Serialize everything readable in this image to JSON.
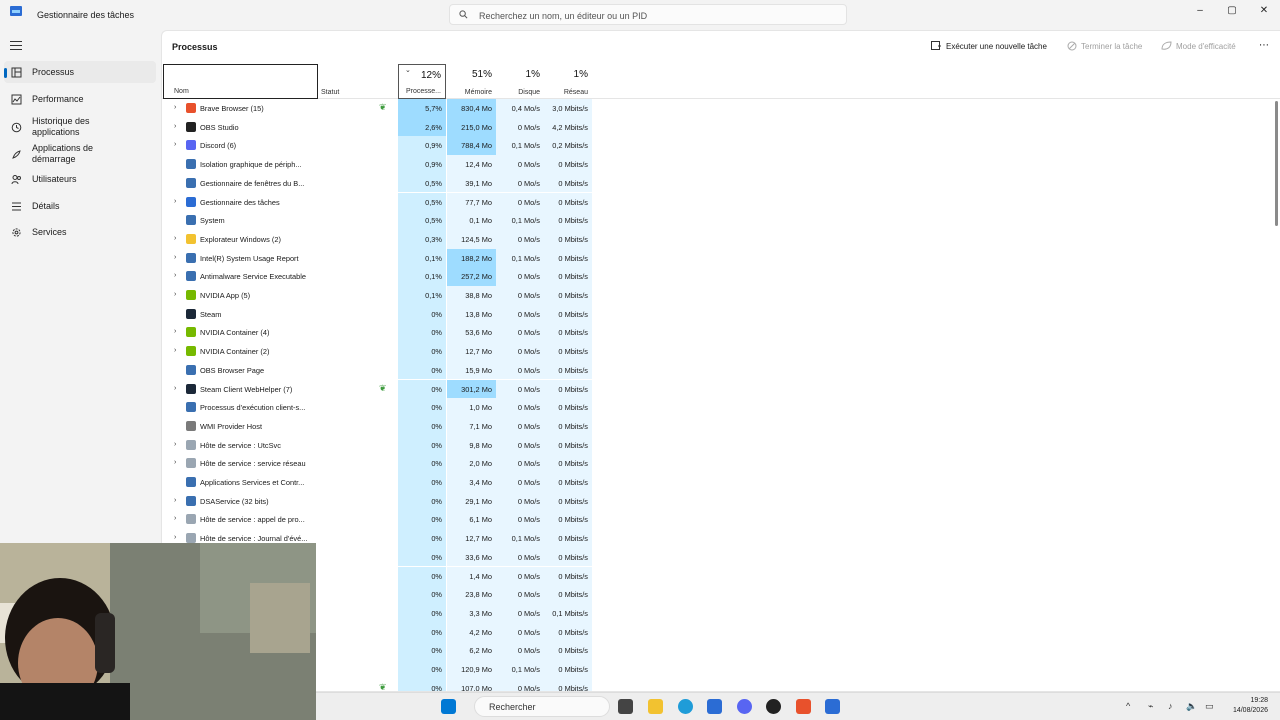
{
  "app": {
    "title": "Gestionnaire des tâches"
  },
  "search": {
    "placeholder": "Recherchez un nom, un éditeur ou un PID"
  },
  "window_controls": {
    "minimize": "–",
    "maximize": "▢",
    "close": "✕"
  },
  "sidebar": {
    "items": [
      {
        "label": "Processus",
        "icon": "processes-icon",
        "active": true
      },
      {
        "label": "Performance",
        "icon": "performance-icon"
      },
      {
        "label": "Historique des applications",
        "icon": "history-icon"
      },
      {
        "label": "Applications de démarrage",
        "icon": "startup-icon"
      },
      {
        "label": "Utilisateurs",
        "icon": "users-icon"
      },
      {
        "label": "Détails",
        "icon": "details-icon"
      },
      {
        "label": "Services",
        "icon": "services-icon"
      }
    ]
  },
  "main": {
    "title": "Processus",
    "toolbar": {
      "run_task": "Exécuter une nouvelle tâche",
      "end_task": "Terminer la tâche",
      "efficiency": "Mode d'efficacité",
      "more": "⋯"
    },
    "columns": {
      "name": "Nom",
      "status": "Statut",
      "cpu": {
        "pct": "12%",
        "label": "Processe..."
      },
      "memory": {
        "pct": "51%",
        "label": "Mémoire"
      },
      "disk": {
        "pct": "1%",
        "label": "Disque"
      },
      "network": {
        "pct": "1%",
        "label": "Réseau"
      }
    },
    "rows": [
      {
        "name": "Brave Browser (15)",
        "expand": true,
        "icon_color": "#e8512c",
        "leaf": true,
        "cpu": "5,7%",
        "mem": "830,4 Mo",
        "disk": "0,4 Mo/s",
        "net": "3,0 Mbits/s"
      },
      {
        "name": "OBS Studio",
        "expand": true,
        "icon_color": "#222222",
        "leaf": false,
        "cpu": "2,6%",
        "mem": "215,0 Mo",
        "disk": "0 Mo/s",
        "net": "4,2 Mbits/s"
      },
      {
        "name": "Discord (6)",
        "expand": true,
        "icon_color": "#5865f2",
        "leaf": false,
        "cpu": "0,9%",
        "mem": "788,4 Mo",
        "disk": "0,1 Mo/s",
        "net": "0,2 Mbits/s"
      },
      {
        "name": "Isolation graphique de périph...",
        "expand": false,
        "icon_color": "#3a6fb0",
        "leaf": false,
        "cpu": "0,9%",
        "mem": "12,4 Mo",
        "disk": "0 Mo/s",
        "net": "0 Mbits/s"
      },
      {
        "name": "Gestionnaire de fenêtres du B...",
        "expand": false,
        "icon_color": "#3a6fb0",
        "leaf": false,
        "cpu": "0,5%",
        "mem": "39,1 Mo",
        "disk": "0 Mo/s",
        "net": "0 Mbits/s"
      },
      {
        "name": "Gestionnaire des tâches",
        "expand": true,
        "icon_color": "#2b6cd4",
        "leaf": false,
        "cpu": "0,5%",
        "mem": "77,7 Mo",
        "disk": "0 Mo/s",
        "net": "0 Mbits/s"
      },
      {
        "name": "System",
        "expand": false,
        "icon_color": "#3a6fb0",
        "leaf": false,
        "cpu": "0,5%",
        "mem": "0,1 Mo",
        "disk": "0,1 Mo/s",
        "net": "0 Mbits/s"
      },
      {
        "name": "Explorateur Windows (2)",
        "expand": true,
        "icon_color": "#f2c230",
        "leaf": false,
        "cpu": "0,3%",
        "mem": "124,5 Mo",
        "disk": "0 Mo/s",
        "net": "0 Mbits/s"
      },
      {
        "name": "Intel(R) System Usage Report",
        "expand": true,
        "icon_color": "#3a6fb0",
        "leaf": false,
        "cpu": "0,1%",
        "mem": "188,2 Mo",
        "disk": "0,1 Mo/s",
        "net": "0 Mbits/s"
      },
      {
        "name": "Antimalware Service Executable",
        "expand": true,
        "icon_color": "#3a6fb0",
        "leaf": false,
        "cpu": "0,1%",
        "mem": "257,2 Mo",
        "disk": "0 Mo/s",
        "net": "0 Mbits/s"
      },
      {
        "name": "NVIDIA App (5)",
        "expand": true,
        "icon_color": "#76b900",
        "leaf": false,
        "cpu": "0,1%",
        "mem": "38,8 Mo",
        "disk": "0 Mo/s",
        "net": "0 Mbits/s"
      },
      {
        "name": "Steam",
        "expand": false,
        "icon_color": "#1b2838",
        "leaf": false,
        "cpu": "0%",
        "mem": "13,8 Mo",
        "disk": "0 Mo/s",
        "net": "0 Mbits/s"
      },
      {
        "name": "NVIDIA Container (4)",
        "expand": true,
        "icon_color": "#76b900",
        "leaf": false,
        "cpu": "0%",
        "mem": "53,6 Mo",
        "disk": "0 Mo/s",
        "net": "0 Mbits/s"
      },
      {
        "name": "NVIDIA Container (2)",
        "expand": true,
        "icon_color": "#76b900",
        "leaf": false,
        "cpu": "0%",
        "mem": "12,7 Mo",
        "disk": "0 Mo/s",
        "net": "0 Mbits/s"
      },
      {
        "name": "OBS Browser Page",
        "expand": false,
        "icon_color": "#3a6fb0",
        "leaf": false,
        "cpu": "0%",
        "mem": "15,9 Mo",
        "disk": "0 Mo/s",
        "net": "0 Mbits/s"
      },
      {
        "name": "Steam Client WebHelper (7)",
        "expand": true,
        "icon_color": "#1b2838",
        "leaf": true,
        "cpu": "0%",
        "mem": "301,2 Mo",
        "disk": "0 Mo/s",
        "net": "0 Mbits/s"
      },
      {
        "name": "Processus d'exécution client-s...",
        "expand": false,
        "icon_color": "#3a6fb0",
        "leaf": false,
        "cpu": "0%",
        "mem": "1,0 Mo",
        "disk": "0 Mo/s",
        "net": "0 Mbits/s"
      },
      {
        "name": "WMI Provider Host",
        "expand": false,
        "icon_color": "#7a7a7a",
        "leaf": false,
        "cpu": "0%",
        "mem": "7,1 Mo",
        "disk": "0 Mo/s",
        "net": "0 Mbits/s"
      },
      {
        "name": "Hôte de service : UtcSvc",
        "expand": true,
        "icon_color": "#9aa6b2",
        "leaf": false,
        "cpu": "0%",
        "mem": "9,8 Mo",
        "disk": "0 Mo/s",
        "net": "0 Mbits/s"
      },
      {
        "name": "Hôte de service : service réseau",
        "expand": true,
        "icon_color": "#9aa6b2",
        "leaf": false,
        "cpu": "0%",
        "mem": "2,0 Mo",
        "disk": "0 Mo/s",
        "net": "0 Mbits/s"
      },
      {
        "name": "Applications Services et Contr...",
        "expand": false,
        "icon_color": "#3a6fb0",
        "leaf": false,
        "cpu": "0%",
        "mem": "3,4 Mo",
        "disk": "0 Mo/s",
        "net": "0 Mbits/s"
      },
      {
        "name": "DSAService (32 bits)",
        "expand": true,
        "icon_color": "#3a6fb0",
        "leaf": false,
        "cpu": "0%",
        "mem": "29,1 Mo",
        "disk": "0 Mo/s",
        "net": "0 Mbits/s"
      },
      {
        "name": "Hôte de service : appel de pro...",
        "expand": true,
        "icon_color": "#9aa6b2",
        "leaf": false,
        "cpu": "0%",
        "mem": "6,1 Mo",
        "disk": "0 Mo/s",
        "net": "0 Mbits/s"
      },
      {
        "name": "Hôte de service : Journal d'évé...",
        "expand": true,
        "icon_color": "#9aa6b2",
        "leaf": false,
        "cpu": "0%",
        "mem": "12,7 Mo",
        "disk": "0,1 Mo/s",
        "net": "0 Mbits/s"
      },
      {
        "name": "",
        "expand": false,
        "icon_color": "",
        "leaf": false,
        "cpu": "0%",
        "mem": "33,6 Mo",
        "disk": "0 Mo/s",
        "net": "0 Mbits/s"
      },
      {
        "name": "",
        "expand": false,
        "icon_color": "",
        "leaf": false,
        "cpu": "0%",
        "mem": "1,4 Mo",
        "disk": "0 Mo/s",
        "net": "0 Mbits/s"
      },
      {
        "name": "",
        "expand": false,
        "icon_color": "",
        "leaf": false,
        "cpu": "0%",
        "mem": "23,8 Mo",
        "disk": "0 Mo/s",
        "net": "0 Mbits/s"
      },
      {
        "name": "",
        "expand": false,
        "icon_color": "",
        "leaf": false,
        "cpu": "0%",
        "mem": "3,3 Mo",
        "disk": "0 Mo/s",
        "net": "0,1 Mbits/s"
      },
      {
        "name": "",
        "expand": false,
        "icon_color": "",
        "leaf": false,
        "cpu": "0%",
        "mem": "4,2 Mo",
        "disk": "0 Mo/s",
        "net": "0 Mbits/s"
      },
      {
        "name": "",
        "expand": false,
        "icon_color": "",
        "leaf": false,
        "cpu": "0%",
        "mem": "6,2 Mo",
        "disk": "0 Mo/s",
        "net": "0 Mbits/s"
      },
      {
        "name": "",
        "expand": false,
        "icon_color": "",
        "leaf": false,
        "cpu": "0%",
        "mem": "120,9 Mo",
        "disk": "0,1 Mo/s",
        "net": "0 Mbits/s"
      },
      {
        "name": "",
        "expand": false,
        "icon_color": "",
        "leaf": true,
        "cpu": "0%",
        "mem": "107,0 Mo",
        "disk": "0 Mo/s",
        "net": "0 Mbits/s"
      }
    ]
  },
  "taskbar": {
    "search_label": "Rechercher",
    "time": "19:28",
    "date": "14/08/2026",
    "apps": [
      {
        "icon": "start-icon",
        "color": "#0078d4"
      },
      {
        "icon": "taskview-icon",
        "color": "#444444"
      },
      {
        "icon": "file-explorer-icon",
        "color": "#f2c230"
      },
      {
        "icon": "edge-icon",
        "color": "#1f9cd8"
      },
      {
        "icon": "store-icon",
        "color": "#2b6cd4"
      },
      {
        "icon": "discord-icon",
        "color": "#5865f2"
      },
      {
        "icon": "obs-icon",
        "color": "#222222"
      },
      {
        "icon": "brave-icon",
        "color": "#e8512c"
      },
      {
        "icon": "task-manager-icon",
        "color": "#2b6cd4"
      }
    ],
    "tray": {
      "chevron": "^",
      "wifi": "⌁",
      "mic": "♪",
      "volume": "🔈",
      "battery": "▭"
    }
  }
}
